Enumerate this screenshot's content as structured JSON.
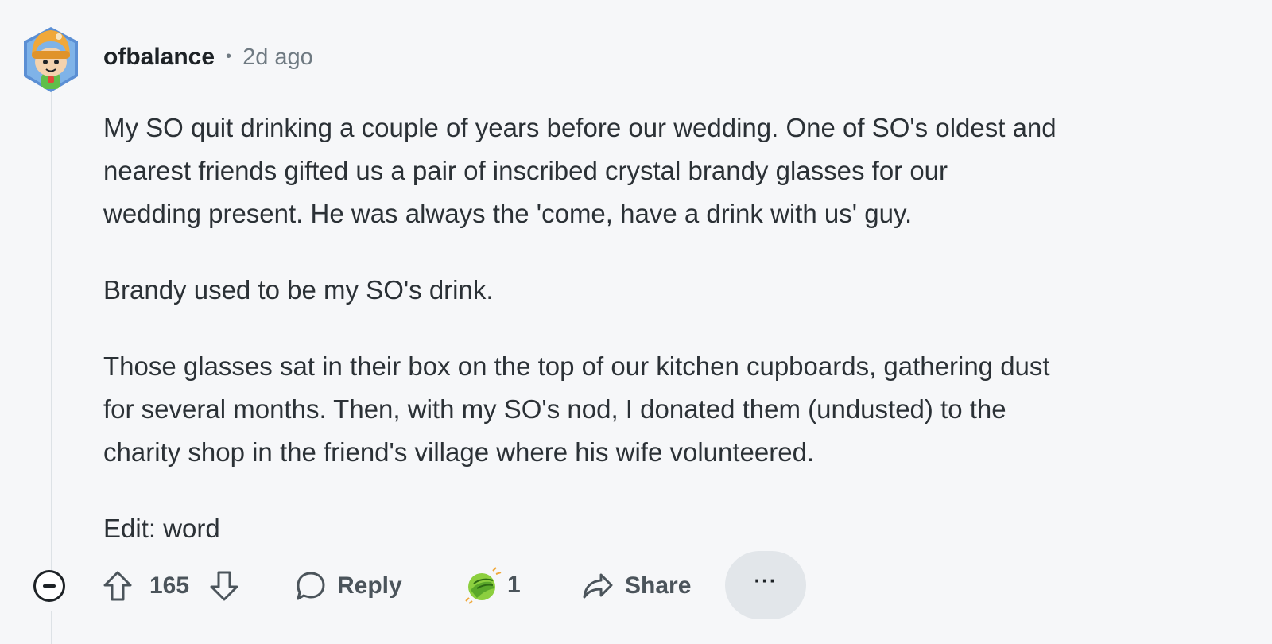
{
  "comment": {
    "username": "ofbalance",
    "separator": "•",
    "timestamp": "2d ago",
    "avatar_icon": "snoo-avatar-beanie",
    "paragraphs": [
      "My SO quit drinking a couple of years before our wedding. One of SO's oldest and\nnearest friends gifted us a pair of inscribed crystal brandy glasses for our\nwedding present. He was always the 'come, have a drink with us' guy.",
      "Brandy used to be my SO's drink.",
      "Those glasses sat in their box on the top of our kitchen cupboards, gathering dust\nfor several months. Then, with my SO's nod, I donated them (undusted) to the\ncharity shop in the friend's village where his wife volunteered.",
      "Edit: word"
    ]
  },
  "actions": {
    "collapse_icon": "minus-circle-icon",
    "upvote_icon": "arrow-up-icon",
    "score": "165",
    "downvote_icon": "arrow-down-icon",
    "reply_icon": "speech-bubble-icon",
    "reply_label": "Reply",
    "award_icon": "facepalm-award-icon",
    "award_count": "1",
    "share_icon": "share-arrow-icon",
    "share_label": "Share",
    "more_label": "···"
  },
  "colors": {
    "background": "#f6f7f9",
    "text": "#2b3136",
    "muted": "#6f7a82",
    "more_button_bg": "#e2e6ea"
  }
}
